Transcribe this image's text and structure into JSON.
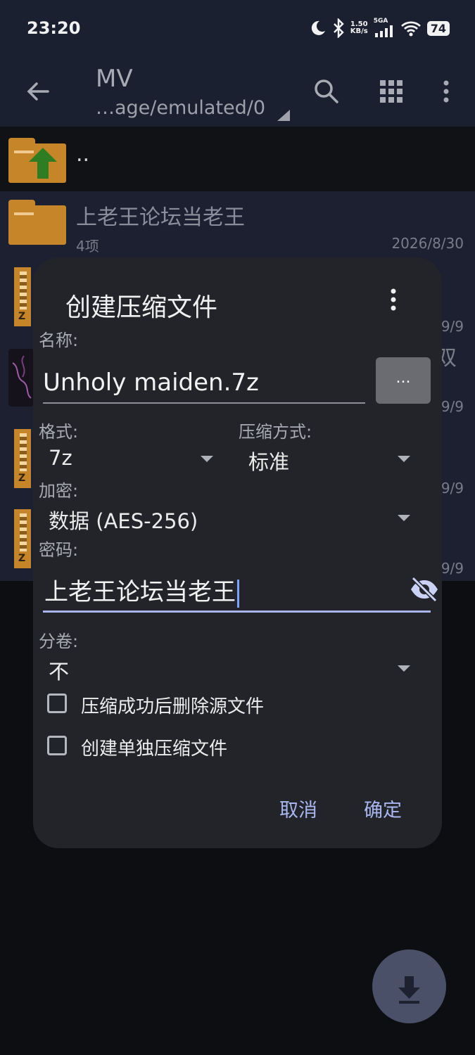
{
  "status_bar": {
    "time": "23:20",
    "net_speed_value": "1.50",
    "net_speed_unit": "KB/s",
    "signal_label": "5GA",
    "battery": "74"
  },
  "app_bar": {
    "title": "MV",
    "path": "…age/emulated/0"
  },
  "file_list": {
    "parent_label": "..",
    "folder": {
      "name": "上老王论坛当老王",
      "count": "4项",
      "date": "2026/8/30"
    },
    "side_dates": [
      "9/9",
      "9/9",
      "9/9",
      "9/9"
    ],
    "side_char": "双",
    "zip_badge": "Z"
  },
  "dialog": {
    "title": "创建压缩文件",
    "name_label": "名称:",
    "name_value": "Unholy maiden.7z",
    "browse_label": "...",
    "format_label": "格式:",
    "format_value": "7z",
    "method_label": "压缩方式:",
    "method_value": "标准",
    "encryption_label": "加密:",
    "encryption_value": "数据 (AES-256)",
    "password_label": "密码:",
    "password_value": "上老王论坛当老王",
    "split_label": "分卷:",
    "split_value": "不",
    "delete_source_label": "压缩成功后删除源文件",
    "separate_archives_label": "创建单独压缩文件",
    "cancel_label": "取消",
    "ok_label": "确定"
  },
  "colors": {
    "accent": "#a9b7f0",
    "folder": "#c7852a",
    "dialog_bg": "#232429",
    "appbar_bg": "#1b2030"
  }
}
